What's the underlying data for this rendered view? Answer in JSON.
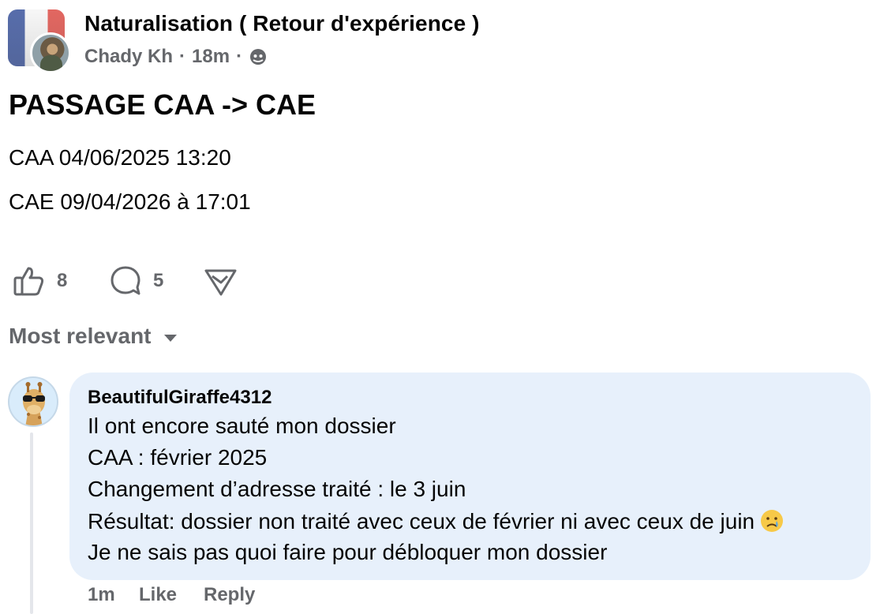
{
  "post": {
    "group_name": "Naturalisation ( Retour d'expérience )",
    "author": "Chady Kh",
    "separator": "·",
    "time": "18m",
    "title": "PASSAGE CAA -> CAE",
    "lines": [
      "CAA 04/06/2025 13:20",
      "CAE 09/04/2026 à 17:01"
    ]
  },
  "actions": {
    "like_count": "8",
    "comment_count": "5"
  },
  "sort": {
    "label": "Most relevant"
  },
  "comment": {
    "author": "BeautifulGiraffe4312",
    "lines": [
      "Il ont encore sauté mon dossier",
      "CAA : février 2025",
      "Changement d’adresse traité : le 3 juin",
      "Résultat: dossier non traité avec ceux de février ni avec ceux de juin",
      "Je ne sais pas quoi faire pour débloquer mon dossier"
    ],
    "time": "1m",
    "like_label": "Like",
    "reply_label": "Reply"
  },
  "colors": {
    "secondary_text": "#65676b",
    "bubble_bg": "#e7f0fb",
    "flag_blue": "#1f3c8f",
    "flag_red": "#d8342c"
  },
  "icons": [
    "globe-icon",
    "thumbs-up-icon",
    "comment-icon",
    "share-icon",
    "caret-down-icon",
    "sad-face-emoji"
  ]
}
